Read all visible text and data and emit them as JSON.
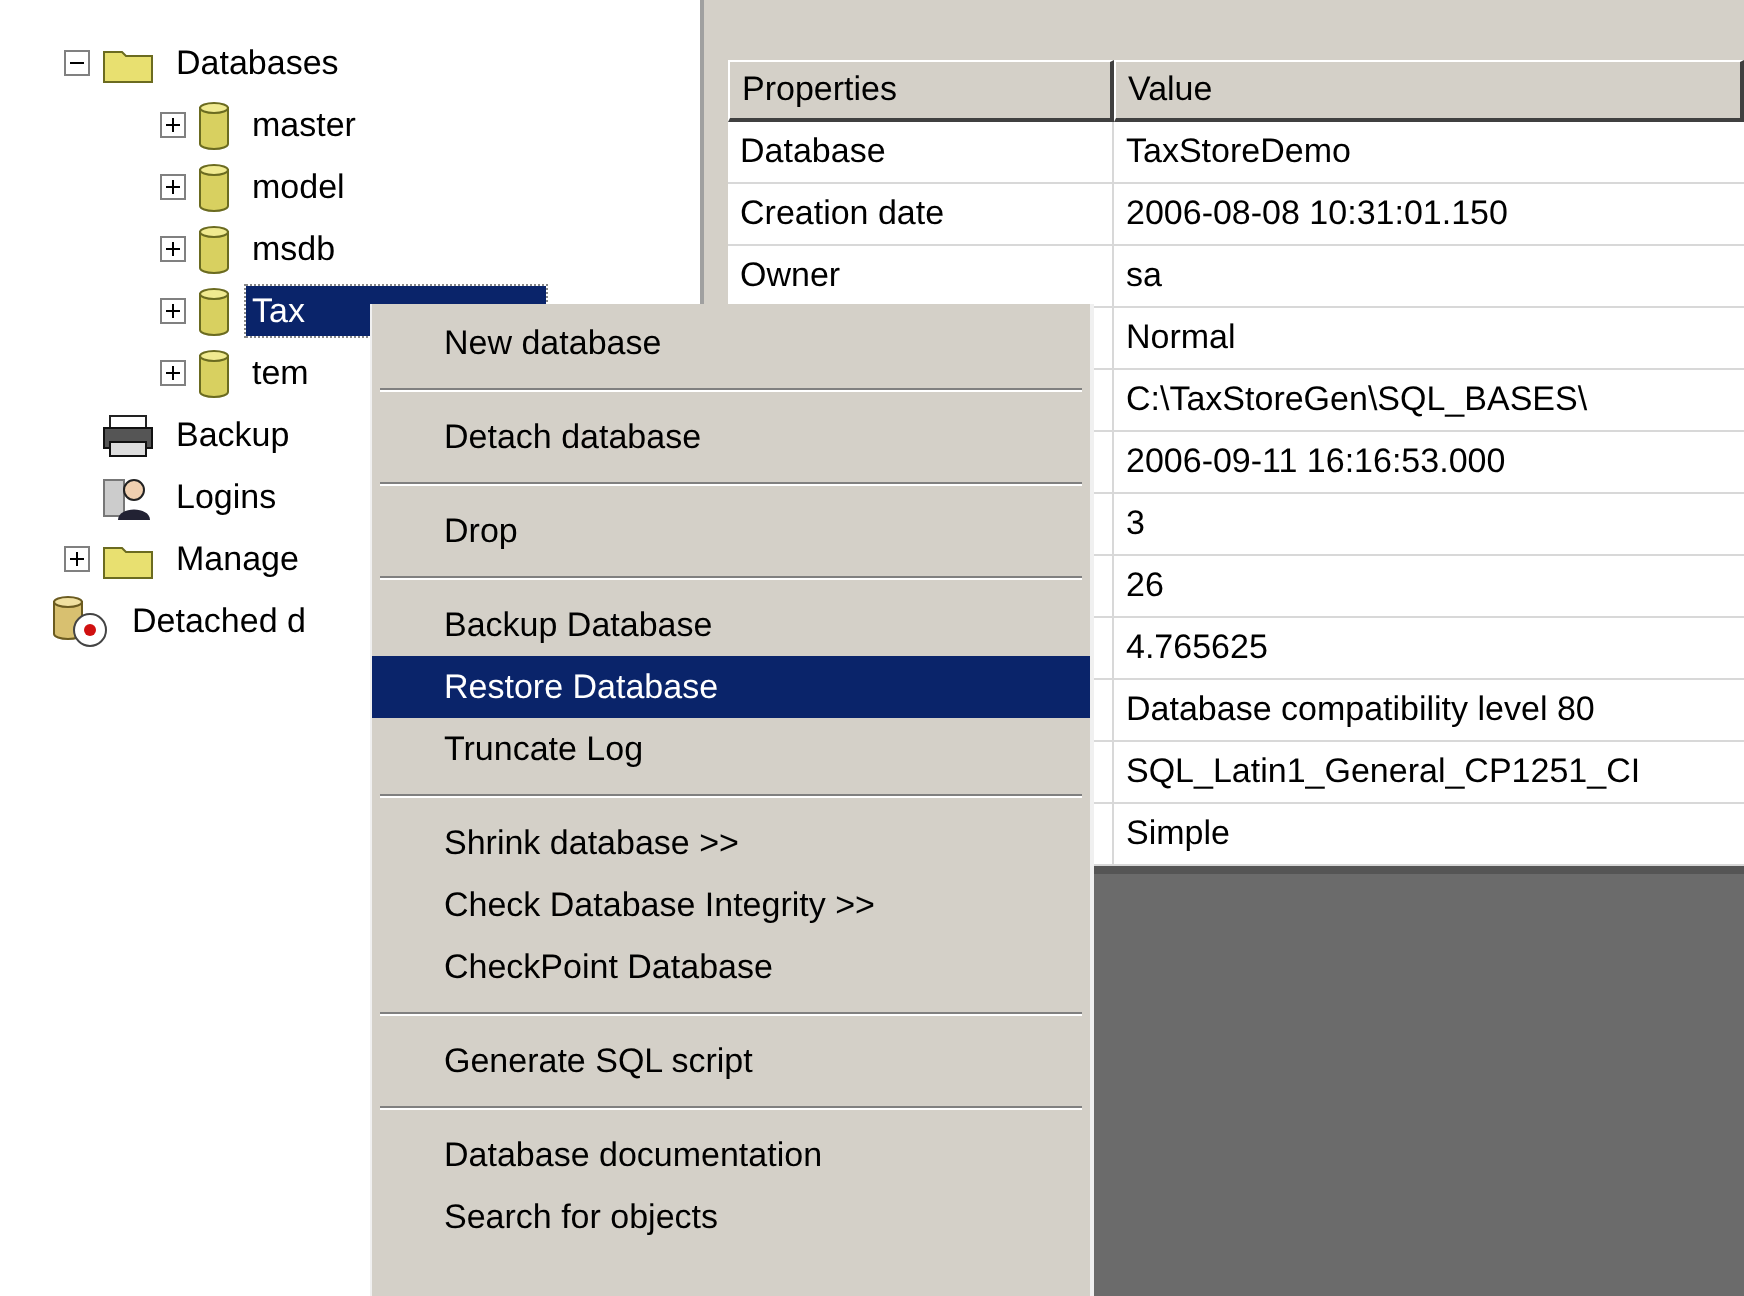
{
  "tree": [
    {
      "label": "Databases",
      "kind": "folder",
      "expanded": true,
      "selected": false,
      "children": [
        {
          "label": "master",
          "kind": "database",
          "expanded": false,
          "selected": false
        },
        {
          "label": "model",
          "kind": "database",
          "expanded": false,
          "selected": false
        },
        {
          "label": "msdb",
          "kind": "database",
          "expanded": false,
          "selected": false
        },
        {
          "label": "Tax",
          "kind": "database",
          "expanded": false,
          "selected": true
        },
        {
          "label": "tem",
          "kind": "database",
          "expanded": false,
          "selected": false
        }
      ]
    },
    {
      "label": "Backup",
      "kind": "backup",
      "selected": false
    },
    {
      "label": "Logins",
      "kind": "logins",
      "selected": false
    },
    {
      "label": "Manage",
      "kind": "folder",
      "expanded": false,
      "selected": false
    }
  ],
  "tree_root": [
    {
      "label": "Detached d",
      "kind": "detached",
      "selected": false
    }
  ],
  "properties": {
    "columns": [
      "Properties",
      "Value"
    ],
    "rows": [
      {
        "property": "Database",
        "value": "TaxStoreDemo"
      },
      {
        "property": "Creation date",
        "value": "2006-08-08 10:31:01.150"
      },
      {
        "property": "Owner",
        "value": "sa"
      },
      {
        "value": "Normal"
      },
      {
        "value": "C:\\TaxStoreGen\\SQL_BASES\\"
      },
      {
        "value": "2006-09-11 16:16:53.000"
      },
      {
        "value": "3"
      },
      {
        "value": "26"
      },
      {
        "value": "4.765625"
      },
      {
        "value": "Database compatibility level 80"
      },
      {
        "value": "SQL_Latin1_General_CP1251_CI"
      },
      {
        "value": "Simple"
      }
    ]
  },
  "context_menu": [
    {
      "kind": "item",
      "label": "New database",
      "selected": false
    },
    {
      "kind": "separator"
    },
    {
      "kind": "item",
      "label": "Detach database",
      "selected": false
    },
    {
      "kind": "separator"
    },
    {
      "kind": "item",
      "label": "Drop",
      "selected": false
    },
    {
      "kind": "separator"
    },
    {
      "kind": "item",
      "label": "Backup Database",
      "selected": false
    },
    {
      "kind": "item",
      "label": "Restore Database",
      "selected": true
    },
    {
      "kind": "item",
      "label": "Truncate Log",
      "selected": false
    },
    {
      "kind": "separator"
    },
    {
      "kind": "item",
      "label": "Shrink database >>",
      "selected": false
    },
    {
      "kind": "item",
      "label": "Check Database Integrity >>",
      "selected": false
    },
    {
      "kind": "item",
      "label": "CheckPoint Database",
      "selected": false
    },
    {
      "kind": "separator"
    },
    {
      "kind": "item",
      "label": "Generate SQL script",
      "selected": false
    },
    {
      "kind": "separator"
    },
    {
      "kind": "item",
      "label": "Database documentation",
      "selected": false
    },
    {
      "kind": "item",
      "label": "Search for objects",
      "selected": false
    }
  ]
}
